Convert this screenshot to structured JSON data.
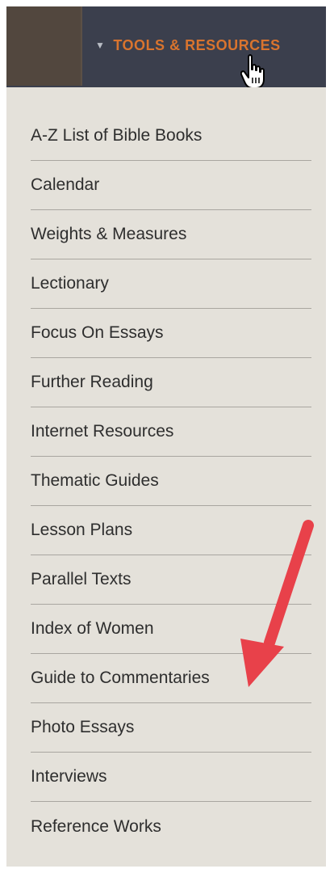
{
  "header": {
    "menu_label": "TOOLS & RESOURCES",
    "caret_icon": "triangle-down-icon",
    "cursor_icon": "hand-pointer-icon"
  },
  "dropdown": {
    "items": [
      {
        "label": "A-Z List of Bible Books"
      },
      {
        "label": "Calendar"
      },
      {
        "label": "Weights & Measures"
      },
      {
        "label": "Lectionary"
      },
      {
        "label": "Focus On Essays"
      },
      {
        "label": "Further Reading"
      },
      {
        "label": "Internet Resources"
      },
      {
        "label": "Thematic Guides"
      },
      {
        "label": "Lesson Plans"
      },
      {
        "label": "Parallel Texts"
      },
      {
        "label": "Index of Women"
      },
      {
        "label": "Guide to Commentaries"
      },
      {
        "label": "Photo Essays"
      },
      {
        "label": "Interviews"
      },
      {
        "label": "Reference Works"
      }
    ]
  },
  "annotation": {
    "icon": "red-arrow-icon",
    "color": "#e8414a"
  },
  "colors": {
    "header_bg": "#3b3f4d",
    "accent": "#d9742e",
    "dropdown_bg": "#e4e1da"
  }
}
